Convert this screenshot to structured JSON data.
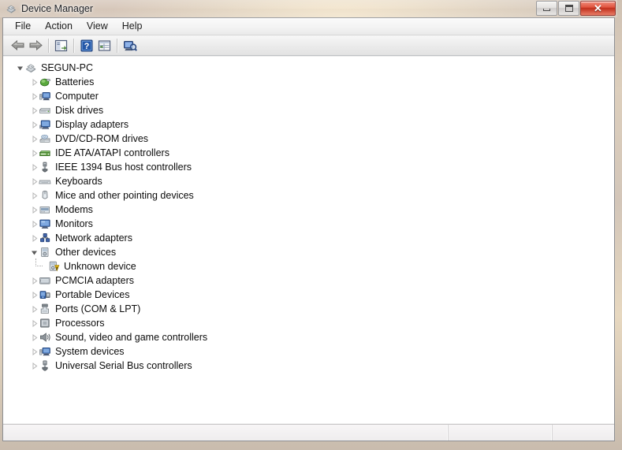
{
  "window": {
    "title": "Device Manager",
    "title_icon": "computer-icon",
    "controls": {
      "minimize": {
        "name": "minimize-button",
        "glyph": "minimize-icon",
        "label": "Minimize"
      },
      "maximize": {
        "name": "maximize-button",
        "glyph": "maximize-icon",
        "label": "Maximize"
      },
      "close": {
        "name": "close-button",
        "glyph": "close-icon",
        "label": "✕"
      }
    }
  },
  "menubar": {
    "items": [
      {
        "label": "File"
      },
      {
        "label": "Action"
      },
      {
        "label": "View"
      },
      {
        "label": "Help"
      }
    ]
  },
  "toolbar": {
    "buttons": [
      {
        "name": "back-button",
        "icon": "arrow-left-icon",
        "tooltip": "Back"
      },
      {
        "name": "forward-button",
        "icon": "arrow-right-icon",
        "tooltip": "Forward"
      },
      {
        "name": "show-hide-console-tree",
        "icon": "console-tree-icon",
        "tooltip": "Show/Hide Console Tree"
      },
      {
        "name": "help-button",
        "icon": "help-question-icon",
        "tooltip": "Help"
      },
      {
        "name": "properties-button",
        "icon": "properties-list-icon",
        "tooltip": "Properties"
      },
      {
        "name": "scan-hardware-button",
        "icon": "scan-hardware-icon",
        "tooltip": "Scan for hardware changes"
      }
    ]
  },
  "tree": {
    "root": {
      "label": "SEGUN-PC",
      "icon": "computer-root-icon",
      "expanded": true,
      "depth": 0
    },
    "items": [
      {
        "label": "Batteries",
        "icon": "battery-icon",
        "expanded": false,
        "depth": 1,
        "warning": false
      },
      {
        "label": "Computer",
        "icon": "computer-node-icon",
        "expanded": false,
        "depth": 1,
        "warning": false
      },
      {
        "label": "Disk drives",
        "icon": "disk-drive-icon",
        "expanded": false,
        "depth": 1,
        "warning": false
      },
      {
        "label": "Display adapters",
        "icon": "display-adapter-icon",
        "expanded": false,
        "depth": 1,
        "warning": false
      },
      {
        "label": "DVD/CD-ROM drives",
        "icon": "optical-drive-icon",
        "expanded": false,
        "depth": 1,
        "warning": false
      },
      {
        "label": "IDE ATA/ATAPI controllers",
        "icon": "ide-controller-icon",
        "expanded": false,
        "depth": 1,
        "warning": false
      },
      {
        "label": "IEEE 1394 Bus host controllers",
        "icon": "firewire-icon",
        "expanded": false,
        "depth": 1,
        "warning": false
      },
      {
        "label": "Keyboards",
        "icon": "keyboard-icon",
        "expanded": false,
        "depth": 1,
        "warning": false
      },
      {
        "label": "Mice and other pointing devices",
        "icon": "mouse-icon",
        "expanded": false,
        "depth": 1,
        "warning": false
      },
      {
        "label": "Modems",
        "icon": "modem-icon",
        "expanded": false,
        "depth": 1,
        "warning": false
      },
      {
        "label": "Monitors",
        "icon": "monitor-icon",
        "expanded": false,
        "depth": 1,
        "warning": false
      },
      {
        "label": "Network adapters",
        "icon": "network-adapter-icon",
        "expanded": false,
        "depth": 1,
        "warning": false
      },
      {
        "label": "Other devices",
        "icon": "other-devices-icon",
        "expanded": true,
        "depth": 1,
        "warning": false
      },
      {
        "label": "Unknown device",
        "icon": "unknown-device-icon",
        "expanded": null,
        "depth": 2,
        "warning": true
      },
      {
        "label": "PCMCIA adapters",
        "icon": "pcmcia-icon",
        "expanded": false,
        "depth": 1,
        "warning": false
      },
      {
        "label": "Portable Devices",
        "icon": "portable-device-icon",
        "expanded": false,
        "depth": 1,
        "warning": false
      },
      {
        "label": "Ports (COM & LPT)",
        "icon": "port-icon",
        "expanded": false,
        "depth": 1,
        "warning": false
      },
      {
        "label": "Processors",
        "icon": "processor-icon",
        "expanded": false,
        "depth": 1,
        "warning": false
      },
      {
        "label": "Sound, video and game controllers",
        "icon": "sound-controller-icon",
        "expanded": false,
        "depth": 1,
        "warning": false
      },
      {
        "label": "System devices",
        "icon": "system-device-icon",
        "expanded": false,
        "depth": 1,
        "warning": false
      },
      {
        "label": "Universal Serial Bus controllers",
        "icon": "usb-controller-icon",
        "expanded": false,
        "depth": 1,
        "warning": false
      }
    ]
  },
  "statusbar": {
    "panes": [
      {
        "text": ""
      },
      {
        "text": ""
      },
      {
        "text": ""
      }
    ]
  },
  "colors": {
    "close_button": "#c0301d",
    "warning_badge": "#f5c518",
    "window_frame": "#8d8f93",
    "tree_background": "#ffffff",
    "text": "#0c0c0c",
    "toolbar_accent": "#2b5ca8"
  }
}
